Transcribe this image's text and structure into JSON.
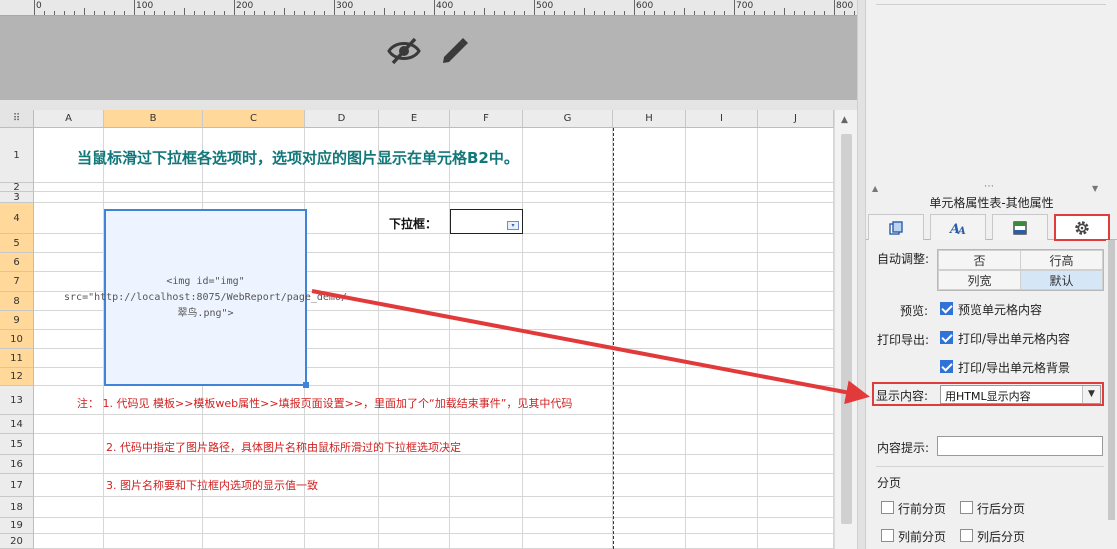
{
  "ruler": {
    "labels": [
      "0",
      "100",
      "200",
      "300",
      "400",
      "500",
      "600",
      "700",
      "800"
    ]
  },
  "header_preview": {
    "icons": [
      "eye-slash-icon",
      "pencil-icon"
    ]
  },
  "sheet": {
    "columns": [
      {
        "label": "A",
        "selected": false
      },
      {
        "label": "B",
        "selected": true
      },
      {
        "label": "C",
        "selected": true
      },
      {
        "label": "D",
        "selected": false
      },
      {
        "label": "E",
        "selected": false
      },
      {
        "label": "F",
        "selected": false
      },
      {
        "label": "G",
        "selected": false
      },
      {
        "label": "H",
        "selected": false
      },
      {
        "label": "I",
        "selected": false
      },
      {
        "label": "J",
        "selected": false
      }
    ],
    "rows": [
      {
        "label": "1",
        "selected": false
      },
      {
        "label": "2",
        "selected": false
      },
      {
        "label": "3",
        "selected": false
      },
      {
        "label": "4",
        "selected": true
      },
      {
        "label": "5",
        "selected": true
      },
      {
        "label": "6",
        "selected": true
      },
      {
        "label": "7",
        "selected": true
      },
      {
        "label": "8",
        "selected": true
      },
      {
        "label": "9",
        "selected": true
      },
      {
        "label": "10",
        "selected": true
      },
      {
        "label": "11",
        "selected": true
      },
      {
        "label": "12",
        "selected": true
      },
      {
        "label": "13",
        "selected": false
      },
      {
        "label": "14",
        "selected": false
      },
      {
        "label": "15",
        "selected": false
      },
      {
        "label": "16",
        "selected": false
      },
      {
        "label": "17",
        "selected": false
      },
      {
        "label": "18",
        "selected": false
      },
      {
        "label": "19",
        "selected": false
      },
      {
        "label": "20",
        "selected": false
      }
    ],
    "title": "当鼠标滑过下拉框各选项时，选项对应的图片显示在单元格B2中。",
    "image_cell_html": "<img id=\"img\" src=\"http://localhost:8075/WebReport/page_demo/翠鸟.png\">",
    "dropdown_label": "下拉框：",
    "notes": [
      "注： 1. 代码见 模板>>模板web属性>>填报页面设置>>，里面加了个“加载结束事件”，见其中代码",
      "2. 代码中指定了图片路径，具体图片名称由鼠标所滑过的下拉框选项决定",
      "3. 图片名称要和下拉框内选项的显示值一致"
    ]
  },
  "panel": {
    "title": "单元格属性表-其他属性",
    "tabs": [
      {
        "icon": "style-icon"
      },
      {
        "icon": "font-icon"
      },
      {
        "icon": "format-icon"
      },
      {
        "icon": "gear-icon"
      }
    ],
    "auto_adjust": {
      "label": "自动调整:",
      "options": [
        "否",
        "行高",
        "列宽",
        "默认"
      ],
      "selected": "默认"
    },
    "preview": {
      "label": "预览:",
      "checkbox": "预览单元格内容",
      "checked": true
    },
    "print_export": {
      "label": "打印导出:",
      "checkboxes": [
        {
          "text": "打印/导出单元格内容",
          "checked": true
        },
        {
          "text": "打印/导出单元格背景",
          "checked": true
        }
      ]
    },
    "display_content": {
      "label": "显示内容:",
      "value": "用HTML显示内容"
    },
    "content_tip": {
      "label": "内容提示:",
      "value": ""
    },
    "pagination": {
      "label": "分页",
      "options": [
        {
          "text": "行前分页",
          "checked": false
        },
        {
          "text": "行后分页",
          "checked": false
        },
        {
          "text": "列前分页",
          "checked": false
        },
        {
          "text": "列后分页",
          "checked": false
        }
      ]
    }
  },
  "colors": {
    "title_text": "#12777a",
    "note_text": "#d12020",
    "highlight": "#e03c3c",
    "selected_header": "#ffd89a",
    "checkbox": "#2f73d6"
  }
}
